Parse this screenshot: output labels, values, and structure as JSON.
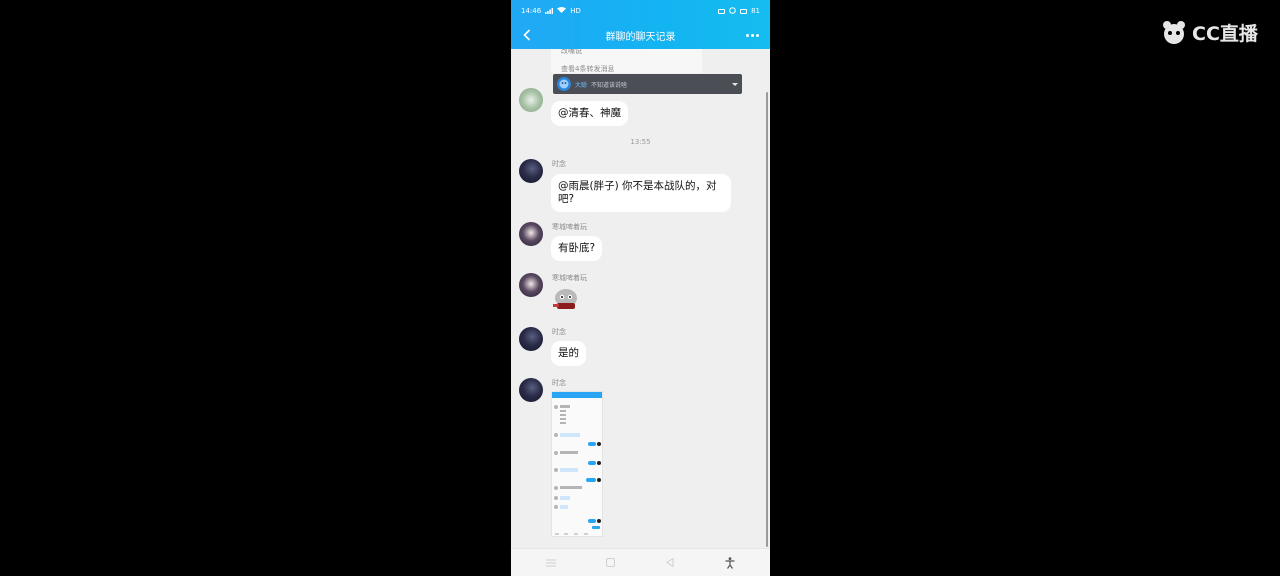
{
  "watermark": {
    "text": "CC直播"
  },
  "status_bar": {
    "time": "14:46",
    "network": "HD",
    "right": "81"
  },
  "navbar": {
    "title": "群聊的聊天记录",
    "back_icon": "chevron-left-icon",
    "more_icon": "more-dots-icon"
  },
  "forward_card": {
    "line1": "改嘴说",
    "line2": "查看4条转发消息"
  },
  "banner": {
    "name": "大聪",
    "text": "不知道该说啥"
  },
  "messages": [
    {
      "sender": "",
      "text": "@清春、神魔"
    },
    {
      "timestamp": "13:55"
    },
    {
      "sender": "时念",
      "text": "@雨晨(胖子) 你不是本战队的，对吧?"
    },
    {
      "sender": "寒城啤着玩",
      "text": "有卧底?"
    },
    {
      "sender": "寒城啤着玩",
      "type": "sticker"
    },
    {
      "sender": "时念",
      "text": "是的"
    },
    {
      "sender": "时念",
      "type": "screenshot"
    }
  ],
  "colors": {
    "header_start": "#21a8f5",
    "header_end": "#16bdf0",
    "chat_bg": "#efefef",
    "bubble": "#ffffff"
  }
}
